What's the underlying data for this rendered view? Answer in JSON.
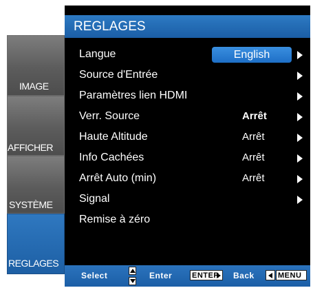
{
  "colors": {
    "accent": "#1e6fc6",
    "panel": "#000000",
    "tab_gray": "#6b6b6b",
    "text": "#ffffff"
  },
  "tabs": [
    {
      "label": "IMAGE",
      "active": false
    },
    {
      "label": "AFFICHER",
      "active": false
    },
    {
      "label": "SYSTÈME",
      "active": false
    },
    {
      "label": "REGLAGES",
      "active": true
    }
  ],
  "header": {
    "title": "REGLAGES"
  },
  "menu": [
    {
      "label": "Langue",
      "value": "English",
      "arrow": true,
      "selected": true
    },
    {
      "label": "Source d'Entrée",
      "value": "",
      "arrow": true
    },
    {
      "label": "Paramètres lien HDMI",
      "value": "",
      "arrow": true
    },
    {
      "label": "Verr. Source",
      "value": "Arrêt",
      "arrow": true,
      "bold": true
    },
    {
      "label": "Haute Altitude",
      "value": "Arrêt",
      "arrow": true
    },
    {
      "label": "Info Cachées",
      "value": "Arrêt",
      "arrow": true
    },
    {
      "label": "Arrêt Auto (min)",
      "value": "Arrêt",
      "arrow": true
    },
    {
      "label": "Signal",
      "value": "",
      "arrow": true
    },
    {
      "label": "Remise à zéro",
      "value": "",
      "arrow": false
    }
  ],
  "footer": {
    "select_label": "Select",
    "enter_label": "Enter",
    "enter_key": "ENTER",
    "back_label": "Back",
    "menu_key": "MENU"
  }
}
